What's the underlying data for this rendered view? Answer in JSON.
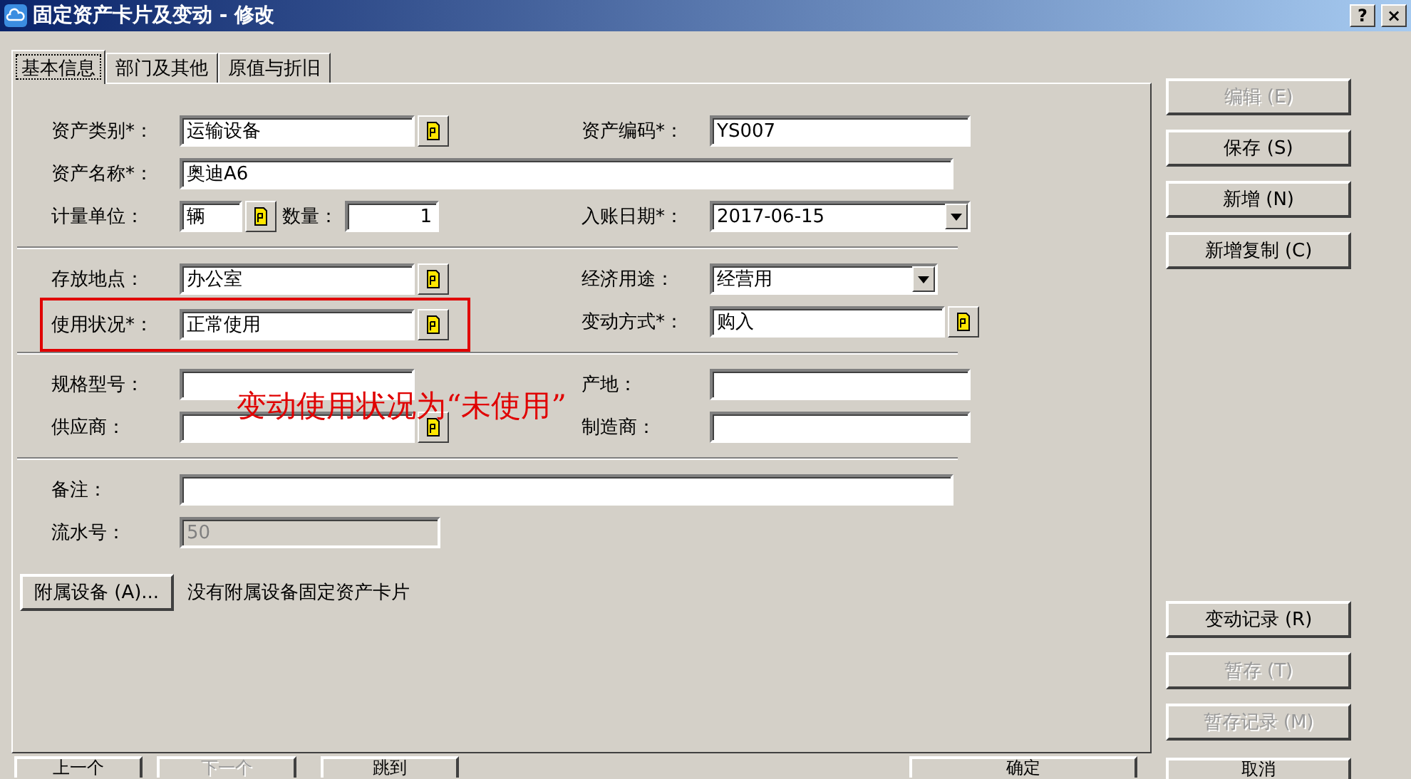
{
  "window": {
    "title": "固定资产卡片及变动 - 修改",
    "help": "?",
    "close": "×"
  },
  "tabs": [
    {
      "label": "基本信息",
      "selected": true
    },
    {
      "label": "部门及其他",
      "selected": false
    },
    {
      "label": "原值与折旧",
      "selected": false
    }
  ],
  "rows": [
    {
      "kind": "pair",
      "left": {
        "label": "资产类别*：",
        "value": "运输设备",
        "kind": "lookup"
      },
      "right": {
        "label": "资产编码*：",
        "value": "YS007",
        "kind": "text"
      }
    },
    {
      "kind": "full",
      "label": "资产名称*：",
      "value": "奥迪A6"
    },
    {
      "kind": "unit",
      "left": {
        "label": "计量单位：",
        "value": "辆"
      },
      "qty": {
        "label": "数量：",
        "value": "1"
      },
      "right": {
        "label": "入账日期*：",
        "value": "2017-06-15",
        "kind": "dropdown"
      }
    },
    {
      "kind": "divider"
    },
    {
      "kind": "pair",
      "left": {
        "label": "存放地点：",
        "value": "办公室",
        "kind": "lookup"
      },
      "right": {
        "label": "经济用途：",
        "value": "经营用",
        "kind": "dropdown"
      }
    },
    {
      "kind": "pair",
      "highlighted": true,
      "left": {
        "label": "使用状况*：",
        "value": "正常使用",
        "kind": "lookup"
      },
      "right": {
        "label": "变动方式*：",
        "value": "购入",
        "kind": "lookup"
      }
    },
    {
      "kind": "divider"
    },
    {
      "kind": "pair",
      "left": {
        "label": "规格型号：",
        "kind": "text"
      },
      "right": {
        "label": "产地：",
        "kind": "text"
      }
    },
    {
      "kind": "pair",
      "left": {
        "label": "供应商：",
        "kind": "lookup"
      },
      "right": {
        "label": "制造商：",
        "kind": "text"
      }
    },
    {
      "kind": "divider"
    },
    {
      "kind": "full",
      "label": "备注："
    },
    {
      "kind": "serial",
      "label": "流水号：",
      "value": "50",
      "disabled": true
    }
  ],
  "attachment": {
    "button": "附属设备 (A)...",
    "note": "没有附属设备固定资产卡片"
  },
  "annotation": "变动使用状况为“未使用”",
  "side_buttons": [
    {
      "label": "编辑 (E)",
      "disabled": true
    },
    {
      "label": "保存 (S)",
      "disabled": false
    },
    {
      "label": "新增 (N)",
      "disabled": false
    },
    {
      "label": "新增复制 (C)",
      "disabled": false
    }
  ],
  "side_buttons_lower": [
    {
      "label": "变动记录 (R)",
      "disabled": false
    },
    {
      "label": "暂存 (T)",
      "disabled": true
    },
    {
      "label": "暂存记录 (M)",
      "disabled": true
    }
  ],
  "bottom_buttons": [
    {
      "label": "上一个",
      "disabled": false
    },
    {
      "label": "下一个",
      "disabled": true
    },
    {
      "label": "跳到",
      "disabled": false
    },
    {
      "label": "确定",
      "disabled": false
    }
  ],
  "cancel_button": {
    "label": "取消",
    "disabled": false
  }
}
